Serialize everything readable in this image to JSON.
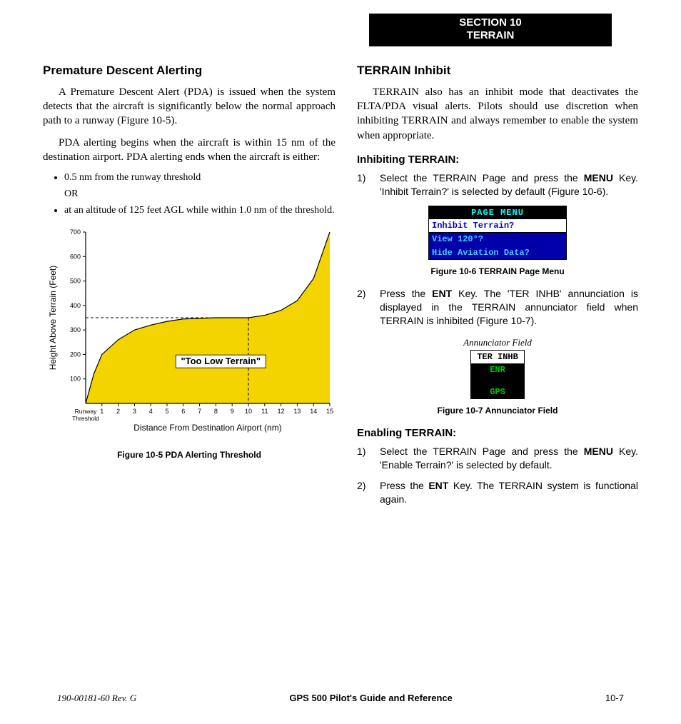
{
  "header": {
    "line1": "SECTION 10",
    "line2": "TERRAIN"
  },
  "left": {
    "h2": "Premature Descent Alerting",
    "p1": "A Premature Descent Alert (PDA) is issued when the system detects that the aircraft is significantly below the normal approach path to a runway (Figure 10-5).",
    "p2": "PDA alerting begins when the aircraft is within 15 nm of the destination airport. PDA alerting ends when the aircraft is either:",
    "li1": "0.5 nm from the runway threshold",
    "li_or": "OR",
    "li2": " at an altitude of 125 feet AGL while within 1.0 nm of the threshold.",
    "fig5": "Figure 10-5  PDA Alerting Threshold"
  },
  "right": {
    "h2": "TERRAIN Inhibit",
    "p1": "TERRAIN also has an inhibit mode that deactivates the FLTA/PDA visual alerts.  Pilots should use discretion when inhibiting TERRAIN and always remember to enable the system when appropriate.",
    "h3a": "Inhibiting TERRAIN:",
    "step1_pre": "Select the TERRAIN Page and press the ",
    "step1_bold": "MENU",
    "step1_post": " Key.  'Inhibit Terrain?' is selected by default (Figure 10-6).",
    "pm_title": "PAGE MENU",
    "pm_sel": "Inhibit Terrain?",
    "pm_r1": "View 120°?",
    "pm_r2": "Hide Aviation Data?",
    "fig6": "Figure 10-6  TERRAIN Page Menu",
    "step2_pre": "Press the ",
    "step2_bold": "ENT",
    "step2_post": " Key.  The 'TER INHB' annunciation is displayed in the TERRAIN annunciator field when TERRAIN is inhibited (Figure 10-7).",
    "ann_label": "Annunciator Field",
    "ann_top": "TER INHB",
    "ann_enr": "ENR",
    "ann_gps": "GPS",
    "fig7": "Figure 10-7  Annunciator Field",
    "h3b": "Enabling TERRAIN:",
    "estep1_pre": "Select the TERRAIN Page and press the ",
    "estep1_bold": "MENU",
    "estep1_post": " Key.  'Enable Terrain?' is selected by default.",
    "estep2_pre": "Press the ",
    "estep2_bold": "ENT",
    "estep2_post": " Key.  The TERRAIN system is functional again."
  },
  "footer": {
    "left": "190-00181-60  Rev. G",
    "center": "GPS 500 Pilot's Guide and Reference",
    "right": "10-7"
  },
  "chart_data": {
    "type": "area",
    "title": "PDA Alerting Threshold",
    "label_in_area": "\"Too Low Terrain\"",
    "xlabel": "Distance From Destination Airport (nm)",
    "ylabel": "Height Above Terrain (Feet)",
    "x_origin_label": "Runway\nThreshold",
    "x_ticks": [
      1,
      2,
      3,
      4,
      5,
      6,
      7,
      8,
      9,
      10,
      11,
      12,
      13,
      14,
      15
    ],
    "y_ticks": [
      100,
      200,
      300,
      400,
      500,
      600,
      700
    ],
    "xlim": [
      0,
      15
    ],
    "ylim": [
      0,
      700
    ],
    "dashed_guides": {
      "x": 10,
      "y": 350
    },
    "curve": [
      {
        "x": 0,
        "y": 0
      },
      {
        "x": 0.5,
        "y": 120
      },
      {
        "x": 1,
        "y": 200
      },
      {
        "x": 2,
        "y": 260
      },
      {
        "x": 3,
        "y": 300
      },
      {
        "x": 4,
        "y": 320
      },
      {
        "x": 5,
        "y": 335
      },
      {
        "x": 6,
        "y": 345
      },
      {
        "x": 8,
        "y": 350
      },
      {
        "x": 10,
        "y": 350
      },
      {
        "x": 11,
        "y": 360
      },
      {
        "x": 12,
        "y": 380
      },
      {
        "x": 13,
        "y": 420
      },
      {
        "x": 14,
        "y": 510
      },
      {
        "x": 15,
        "y": 700
      }
    ]
  }
}
